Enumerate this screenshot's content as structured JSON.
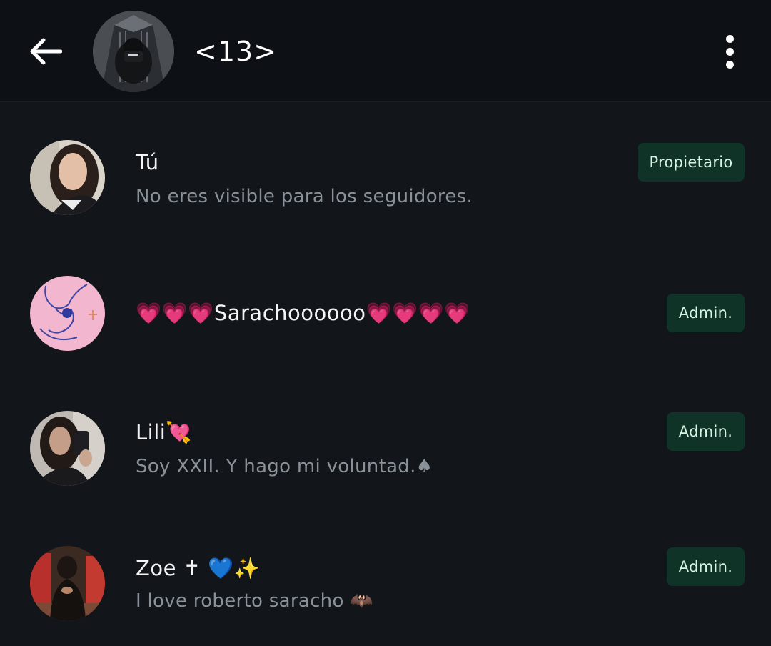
{
  "header": {
    "back_icon": "arrow-left-icon",
    "title": "<13>",
    "menu_icon": "more-vertical-icon"
  },
  "members": [
    {
      "name": "Tú",
      "subtitle": "No eres visible para los seguidores.",
      "role": "Propietario"
    },
    {
      "name": "💗💗💗Sarachoooooo💗💗💗💗",
      "subtitle": "",
      "role": "Admin."
    },
    {
      "name": "Lili💘",
      "subtitle": "Soy XXII. Y hago mi voluntad.♠",
      "role": "Admin."
    },
    {
      "name": "Zoe ✝ 💙✨",
      "subtitle": "I love roberto saracho 🦇",
      "role": "Admin."
    }
  ],
  "colors": {
    "background": "#121519",
    "header_background": "#0d1115",
    "badge_background": "#0f3327",
    "badge_text": "#d7f3e4",
    "subtitle_text": "#8a9299"
  }
}
